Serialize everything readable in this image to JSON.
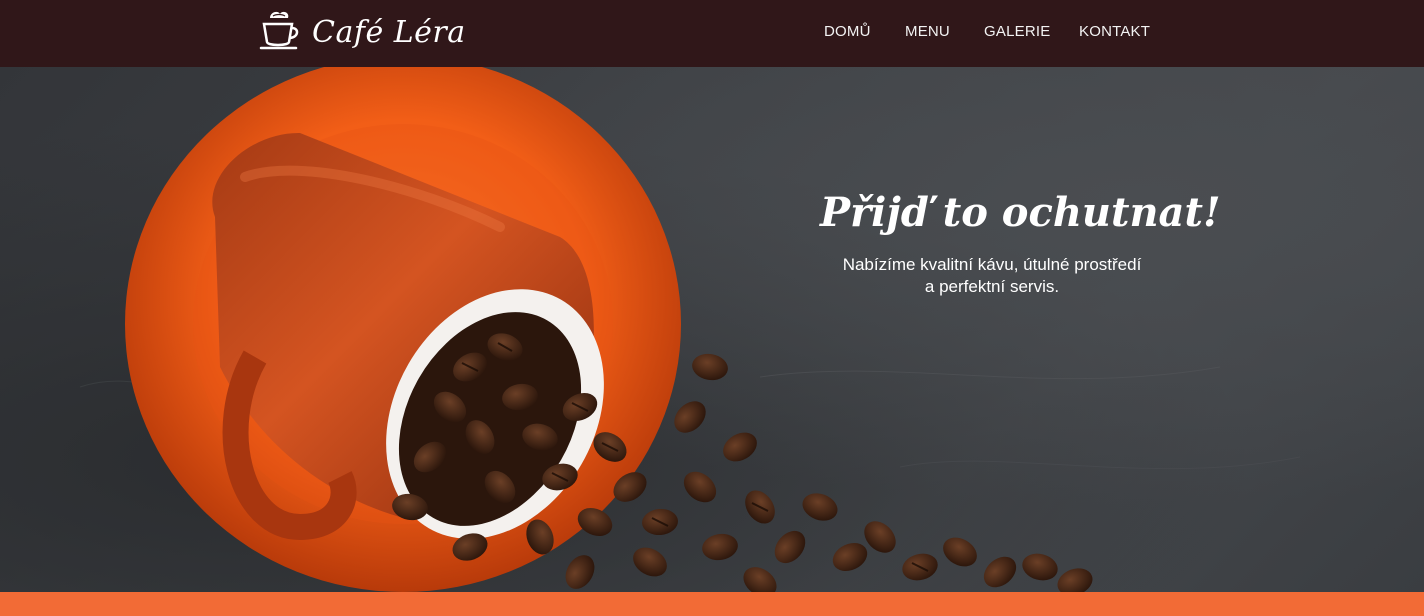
{
  "brand": {
    "name": "Café Léra",
    "icon": "coffee-cup-icon"
  },
  "nav": {
    "items": [
      {
        "label": "DOMŮ"
      },
      {
        "label": "MENU"
      },
      {
        "label": "GALERIE"
      },
      {
        "label": "KONTAKT"
      }
    ]
  },
  "hero": {
    "title": "Přijď to ochutnat!",
    "text": "Nabízíme kvalitní kávu, útulné prostředí a perfektní servis.",
    "image": "coffee-cup-with-beans"
  },
  "colors": {
    "navbar": "#301719",
    "accent": "#f26b36",
    "cup": "#c8461a",
    "slate": "#3d4044"
  }
}
